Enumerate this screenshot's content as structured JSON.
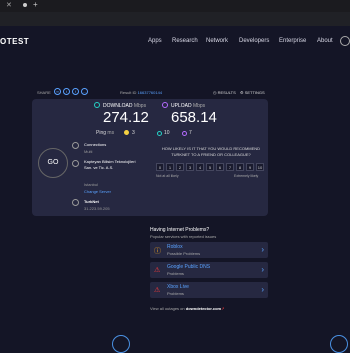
{
  "browser": {
    "tab_title": "Speedtest by Ookla",
    "new_tab": "+"
  },
  "nav": {
    "logo": "OTEST",
    "links": [
      "Apps",
      "Research",
      "Network",
      "Developers",
      "Enterprise",
      "About"
    ]
  },
  "share": {
    "label": "SHARE",
    "icons": [
      "link-icon",
      "twitter-icon",
      "facebook-icon",
      "more-icon"
    ],
    "result_prefix": "Result ID",
    "result_id": "16637760144",
    "results_label": "RESULTS",
    "settings_label": "SETTINGS"
  },
  "test": {
    "go_label": "GO",
    "download": {
      "label": "DOWNLOAD",
      "unit": "Mbps",
      "value": "274.12",
      "color": "#25d2c6"
    },
    "upload": {
      "label": "UPLOAD",
      "unit": "Mbps",
      "value": "658.14",
      "color": "#b56bff"
    },
    "ping": {
      "label": "Ping",
      "unit": "ms",
      "idle": "3",
      "download_ping": "10",
      "upload_ping": "7"
    }
  },
  "connection": {
    "connections_label": "Connections",
    "connections_value": "Multi",
    "isp_name": "Kapteyan Bilisim Teknolojileri San. ve Tic. A.S.",
    "location": "Istanbul",
    "change_server": "Change Server",
    "host": "TurkNet",
    "ip": "31.223.59.205"
  },
  "survey": {
    "question": "HOW LIKELY IS IT THAT YOU WOULD RECOMMEND TURKNET TO A FRIEND OR COLLEAGUE?",
    "scale": [
      "0",
      "1",
      "2",
      "3",
      "4",
      "5",
      "6",
      "7",
      "8",
      "9",
      "10"
    ],
    "low_label": "Not at all likely",
    "high_label": "Extremely likely"
  },
  "problems": {
    "title": "Having Internet Problems?",
    "subtitle": "Popular services with reported issues",
    "items": [
      {
        "name": "Roblox",
        "status": "Possible Problems",
        "icon": "warning-icon",
        "color": "#f5a623"
      },
      {
        "name": "Google Public DNS",
        "status": "Problems",
        "icon": "alert-icon",
        "color": "#ff3b3b"
      },
      {
        "name": "Xbox Live",
        "status": "Problems",
        "icon": "alert-icon",
        "color": "#ff3b3b"
      }
    ],
    "view_all_prefix": "View all outages on",
    "view_all_site": "downdetector.com"
  }
}
